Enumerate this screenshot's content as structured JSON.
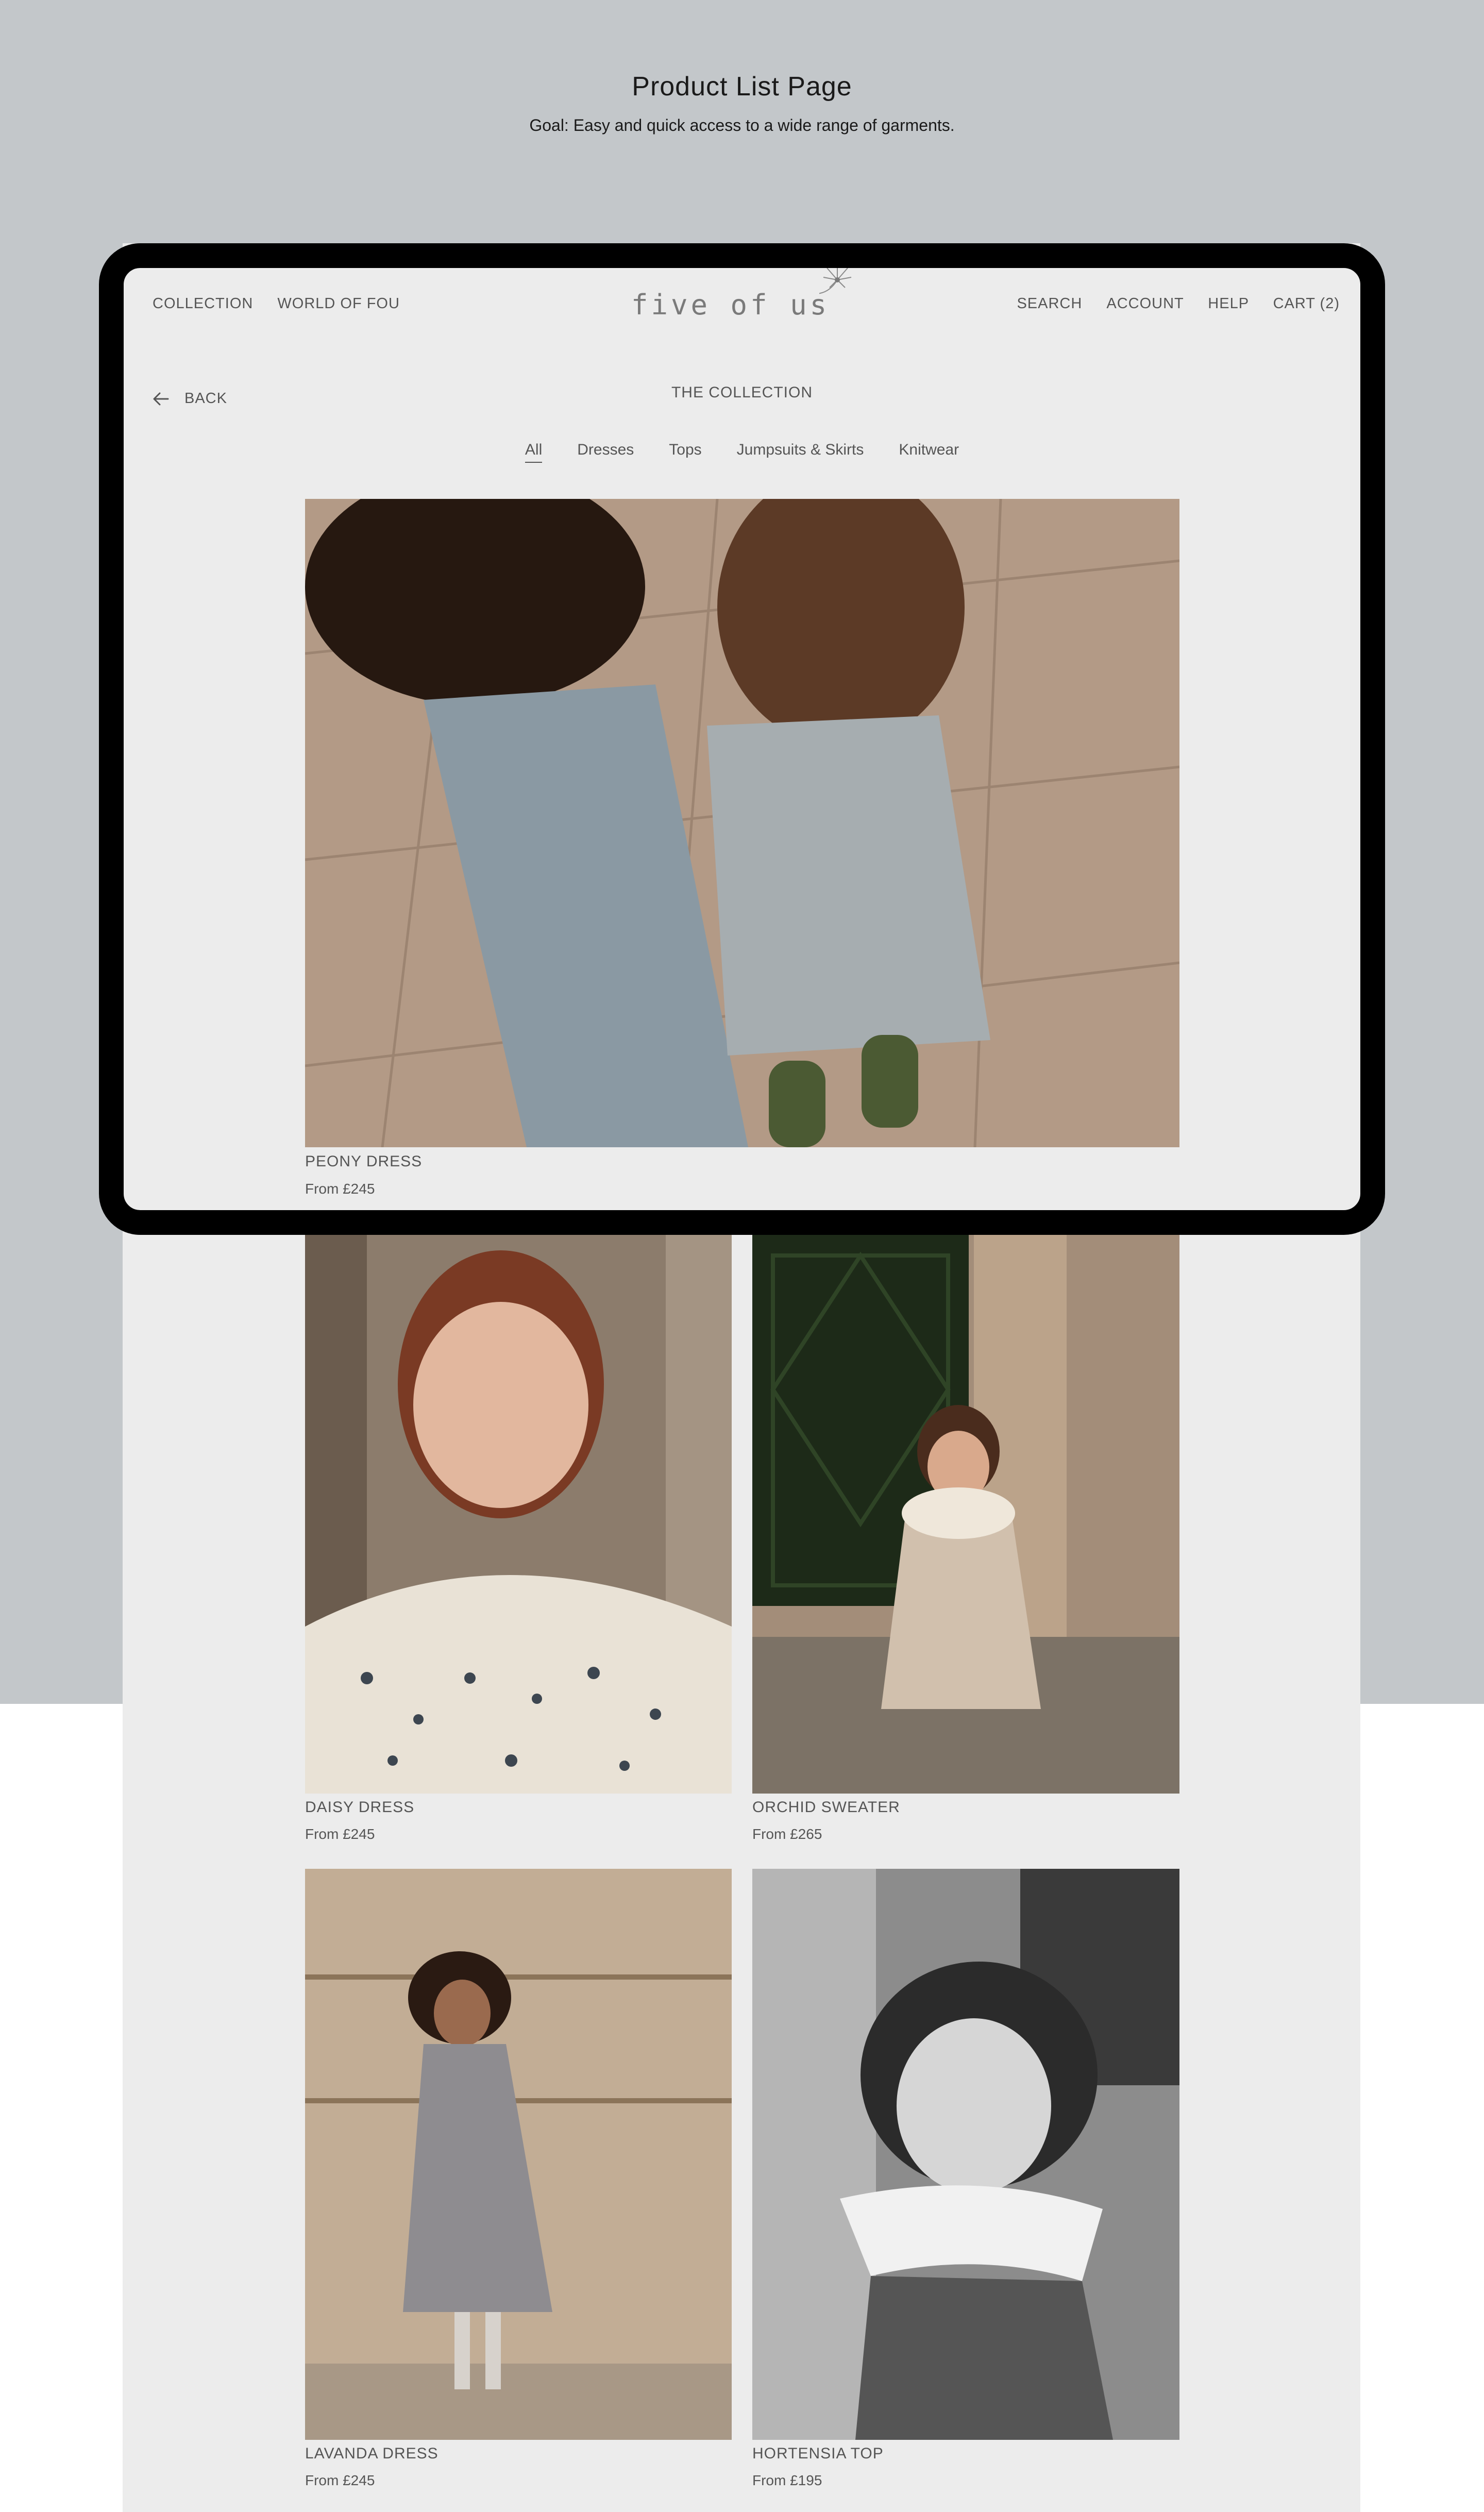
{
  "presentation": {
    "title": "Product List Page",
    "goal": "Goal: Easy and quick access to a wide range of garments.",
    "background": "#c3c7ca"
  },
  "header": {
    "nav_left": [
      "COLLECTION",
      "WORLD OF FOU"
    ],
    "logo": "five of us",
    "nav_right": [
      "SEARCH",
      "ACCOUNT",
      "HELP",
      "CART (2)"
    ]
  },
  "back_label": "BACK",
  "collection_title": "THE COLLECTION",
  "filters": {
    "active": "All",
    "items": [
      "All",
      "Dresses",
      "Tops",
      "Jumpsuits & Skirts",
      "Knitwear"
    ]
  },
  "products": [
    {
      "name": "PEONY DRESS",
      "price": "From £245"
    },
    {
      "name": "DAISY DRESS",
      "price": "From £245"
    },
    {
      "name": "ORCHID SWEATER",
      "price": "From £265"
    },
    {
      "name": "LAVANDA DRESS",
      "price": "From £245"
    },
    {
      "name": "HORTENSIA TOP",
      "price": "From £195"
    }
  ]
}
